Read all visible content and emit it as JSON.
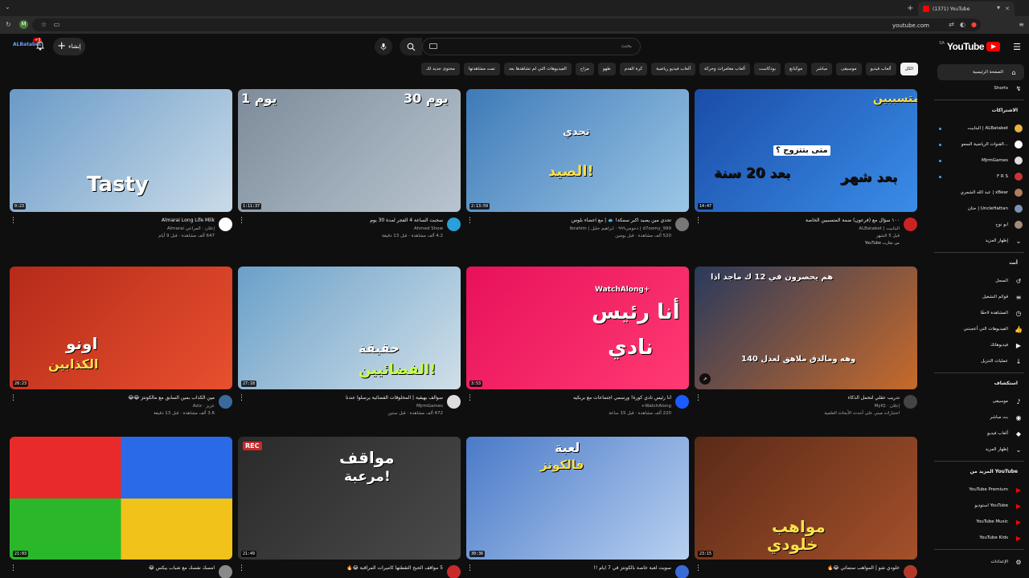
{
  "browser": {
    "tab_title": "(1371) YouTube",
    "url": "youtube.com",
    "profile_initial": "M"
  },
  "header": {
    "logo_text": "YouTube",
    "logo_region": "SA",
    "search_placeholder": "بحث",
    "create_label": "إنشاء",
    "notif_count": "+9",
    "account_label": "ALBatabet"
  },
  "chips": [
    "الكل",
    "ألعاب فيديو",
    "موسيقى",
    "مباشر",
    "موكبانغ",
    "بودكاست",
    "ألعاب مغامرات وحركة",
    "ألعاب فيديو رياضية",
    "كرة القدم",
    "طهو",
    "مزاح",
    "الفيديوهات التي لم تشاهدها بعد",
    "تمت مشاهدتها",
    "محتوى جديد لك"
  ],
  "sidebar": {
    "home": "الصفحة الرئيسية",
    "shorts": "Shorts",
    "subs_head": "الاشتراكات",
    "subs": [
      {
        "label": "البتابيت | ALBatabet",
        "color": "#e3b341"
      },
      {
        "label": "القنوات الرياضية السعو...",
        "color": "#ffffff"
      },
      {
        "label": "MjrmGames",
        "color": "#dddddd"
      },
      {
        "label": "F R S",
        "color": "#cc3333"
      },
      {
        "label": "عبد الله الشمري | xBear",
        "color": "#b07d5a"
      },
      {
        "label": "حتان | UncleHattan",
        "color": "#7a93b5"
      },
      {
        "label": "ابو نوح",
        "color": "#a38d7a"
      }
    ],
    "subs_more": "إظهار المزيد",
    "you_head": "أنت",
    "you_items": [
      "السجل",
      "قوائم التشغيل",
      "المشاهدة لاحقًا",
      "الفيديوهات التي أعجبتني",
      "فيديوهاتك",
      "عمليات التنزيل"
    ],
    "explore_head": "استكشاف",
    "explore_items": [
      "موسيقى",
      "بث مباشر",
      "ألعاب فيديو",
      "إظهار المزيد"
    ],
    "more_head": "المزيد من YouTube",
    "more_items": [
      "YouTube Premium",
      "استوديو YouTube",
      "YouTube Music",
      "YouTube Kids"
    ],
    "settings": "الإعدادات"
  },
  "videos": [
    {
      "title": "١٠٠ سؤال مع (فرعون) ضمة المتسببين الخاصة",
      "channel": "البتابيت | ALBatabet",
      "stats": "قبل 5 الشهر",
      "extra": "من تجارب YouTube",
      "duration": "14:47",
      "thumb_text": [
        "المتسببين",
        "متى بتتزوج ؟",
        "بعد 20 سنة",
        "بعد شهر"
      ],
      "bg": [
        "#1a4da8",
        "#3a8de8"
      ],
      "av": "#cc2222"
    },
    {
      "title": "تحدي مين يصيد اكبر سمكة! 🐟 | مع اعضاء بلوس",
      "channel": "d7oomy_999 | دحومي٩٩٩ · ابراهيم خليل | Ibrahim",
      "stats": "520 ألف مشاهدة · قبل يومين",
      "extra": "",
      "duration": "2:13:59",
      "thumb_text": [
        "تحدي",
        "الصيد!"
      ],
      "bg": [
        "#3e7ab8",
        "#9cc6e6"
      ],
      "av": "#777777"
    },
    {
      "title": "سحبت الساعة 4 الفجر لمدة 30 يوم",
      "channel": "Ahmed Show",
      "stats": "4.2 ألف مشاهدة · قبل 13 دقيقة",
      "extra": "",
      "duration": "1:11:37",
      "thumb_text": [
        "يوم 1",
        "يوم 30"
      ],
      "bg": [
        "#7d8b9a",
        "#b8c5d0"
      ],
      "av": "#2a9fd8"
    },
    {
      "title": "Almarai Long Life Milk",
      "channel": "إعلان · المراعي Almarai",
      "stats": "647 ألف مشاهدة · قبل 9 أيام",
      "extra": "",
      "duration": "0:23",
      "thumb_text": [
        "Tasty"
      ],
      "bg": [
        "#6a9ac8",
        "#c9dbe8"
      ],
      "av": "#ffffff"
    },
    {
      "title": "تدريب عقلي لتحمل الذكاء",
      "channel": "إعلان · MyIQ",
      "stats": "اختبارات مبني على أحدث الأبحاث العلمية",
      "extra": "",
      "duration": "",
      "thumb_text": [
        "هم يحصرون في 12 ك ماجد اذا",
        "140 وهه ومالدق ملاهق لعدل"
      ],
      "bg": [
        "#2a3a5c",
        "#c86a2a"
      ],
      "av": "#444444"
    },
    {
      "title": "أنا رئيس نادي كورة! ورسمي اجتماعات مع بربكيه",
      "channel": "WatchAlong+",
      "stats": "220 ألف مشاهدة · قبل 15 ساعة",
      "extra": "",
      "duration": "3:53",
      "thumb_text": [
        "WatchAlong+",
        "أنا رئيس",
        "نادي"
      ],
      "bg": [
        "#e8115b",
        "#ff3a72"
      ],
      "av": "#1a5cff"
    },
    {
      "title": "سوالف بهيقية | المخلوقات الفضائية يرسلوا عندنا",
      "channel": "MjrmGames",
      "stats": "472 ألف مشاهدة · قبل ستين",
      "extra": "",
      "duration": "27:18",
      "thumb_text": [
        "حقيقة",
        "الفضائيين!"
      ],
      "bg": [
        "#6ba0c9",
        "#cfdfe8"
      ],
      "av": "#dddddd"
    },
    {
      "title": "مين الكذاب بمين السابق مع مالكونتز 😂😂",
      "channel": "عزيز · Aziz",
      "stats": "3.6 ألف مشاهدة · قبل 13 دقيقة",
      "extra": "",
      "duration": "28:23",
      "thumb_text": [
        "اونو",
        "الكذابين"
      ],
      "bg": [
        "#b52a1a",
        "#e8502e"
      ],
      "av": "#3a6a9a"
    },
    {
      "title": "خلودي شو | المواهب ستماتي 😂🔥",
      "channel": "",
      "stats": "",
      "extra": "",
      "duration": "23:15",
      "thumb_text": [
        "مواهب",
        "خلودي"
      ],
      "bg": [
        "#5a2a18",
        "#a4502a"
      ],
      "av": "#b33a2a"
    },
    {
      "title": "سويت لعبة خاصة بالكونتز في 7 ايام !!",
      "channel": "",
      "stats": "",
      "extra": "",
      "duration": "30:36",
      "thumb_text": [
        "لعبة",
        "فالكونز"
      ],
      "bg": [
        "#4a7ac8",
        "#b8d0f0"
      ],
      "av": "#3a6ad8"
    },
    {
      "title": "5 مواقف الحبح التقطتها كاميرات المراقبة 😂🔥",
      "channel": "",
      "stats": "",
      "extra": "",
      "duration": "21:49",
      "thumb_text": [
        "REC",
        "مواقف",
        "مرعبة!"
      ],
      "bg": [
        "#2a2a2a",
        "#4a4a4a"
      ],
      "av": "#c82a2a"
    },
    {
      "title": "امسك نفسك مع شباب بيكس 😂",
      "channel": "",
      "stats": "",
      "extra": "",
      "duration": "21:03",
      "thumb_text": [],
      "bg": [
        "#e82a2a",
        "#2a6ae8"
      ],
      "av": "#8a8a8a"
    }
  ]
}
